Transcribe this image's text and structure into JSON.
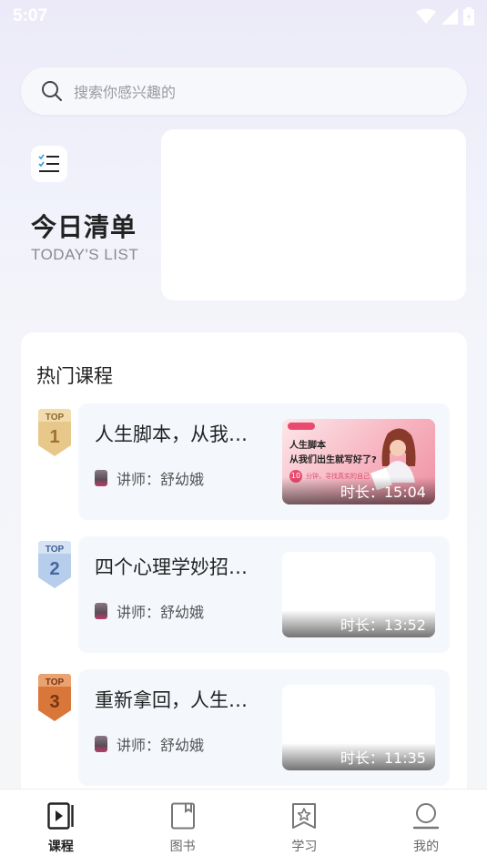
{
  "status": {
    "time": "5:07"
  },
  "search": {
    "placeholder": "搜索你感兴趣的"
  },
  "today": {
    "title": "今日清单",
    "subtitle": "TODAY'S LIST"
  },
  "hot": {
    "title": "热门课程",
    "courses": [
      {
        "rank_label": "TOP",
        "rank": "1",
        "title": "人生脚本，从我…",
        "lecturer": "讲师：舒幼娥",
        "duration": "时长：15:04",
        "thumb_line1": "人生脚本",
        "thumb_line2": "从我们出生就写好了?",
        "thumb_num": "10",
        "thumb_small": "分钟，寻找真实的自己"
      },
      {
        "rank_label": "TOP",
        "rank": "2",
        "title": "四个心理学妙招…",
        "lecturer": "讲师：舒幼娥",
        "duration": "时长：13:52"
      },
      {
        "rank_label": "TOP",
        "rank": "3",
        "title": "重新拿回，人生…",
        "lecturer": "讲师：舒幼娥",
        "duration": "时长：11:35"
      }
    ]
  },
  "tabs": [
    {
      "label": "课程",
      "icon": "course-play-icon",
      "active": true
    },
    {
      "label": "图书",
      "icon": "book-icon",
      "active": false
    },
    {
      "label": "学习",
      "icon": "study-star-icon",
      "active": false
    },
    {
      "label": "我的",
      "icon": "profile-icon",
      "active": false
    }
  ],
  "colors": {
    "gold": "#d9a94f",
    "silver": "#6f93c8",
    "bronze": "#d0733a",
    "accent": "#e94b6f"
  }
}
